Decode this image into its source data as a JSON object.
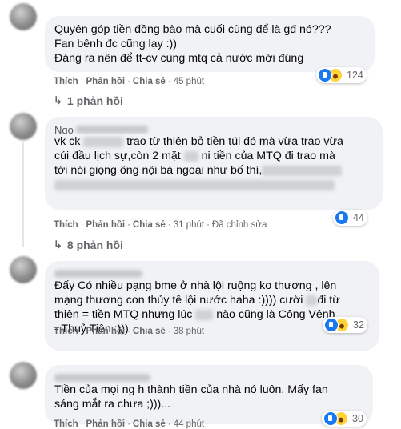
{
  "comments": [
    {
      "lines": [
        "Quyên góp tiền đồng bào mà cuối cùng để là gđ nó???",
        "Fan bênh đc cũng lạy :))",
        "Đáng ra nên để tt-cv cùng mtq cả nước mới đúng"
      ],
      "actions": {
        "like": "Thích",
        "reply": "Phản hồi",
        "share": "Chia sẻ",
        "time": "45 phút"
      },
      "reactions": {
        "count": "124"
      },
      "replies_label": "1 phản hồi"
    },
    {
      "name_fragment": "Ngo",
      "line1_a": "vk ck",
      "line1_b": "trao từ thiện bỏ tiền túi đó mà vừa trao vừa",
      "line2_a": "cúi đầu lịch sự,còn 2 mặt",
      "line2_b": "ni tiền của MTQ đi trao mà",
      "line3_a": "tới nói giọng ông nội bà ngoại như bố thí,",
      "actions": {
        "like": "Thích",
        "reply": "Phản hồi",
        "share": "Chia sẻ",
        "time": "31 phút",
        "edited": "Đã chỉnh sửa"
      },
      "reactions": {
        "count": "44"
      },
      "replies_label": "8 phản hồi"
    },
    {
      "line1": "Đấy Có nhiều pạng bme ở nhà lội ruộng ko thương , lên",
      "line2": "mạng thương con thủy tề lội nước haha :))))",
      "line2_b": "cười",
      "line2_c": "đi từ",
      "line3_a": "thiện = tiền MTQ nhưng lúc",
      "line3_b": "nào cũng là Công Vênh",
      "line4": "- Thuỷ Tiên :)))",
      "actions": {
        "like": "Thích",
        "reply": "Phản hồi",
        "share": "Chia sẻ",
        "time": "38 phút"
      },
      "reactions": {
        "count": "32"
      }
    },
    {
      "lines": [
        "Tiền của mọi ng h thành tiền của nhà nó luôn. Mấy fan",
        "sáng mắt ra chưa ;)))..."
      ],
      "actions": {
        "like": "Thích",
        "reply": "Phản hồi",
        "share": "Chia sẻ",
        "time": "44 phút"
      },
      "reactions": {
        "count": "30"
      }
    }
  ]
}
